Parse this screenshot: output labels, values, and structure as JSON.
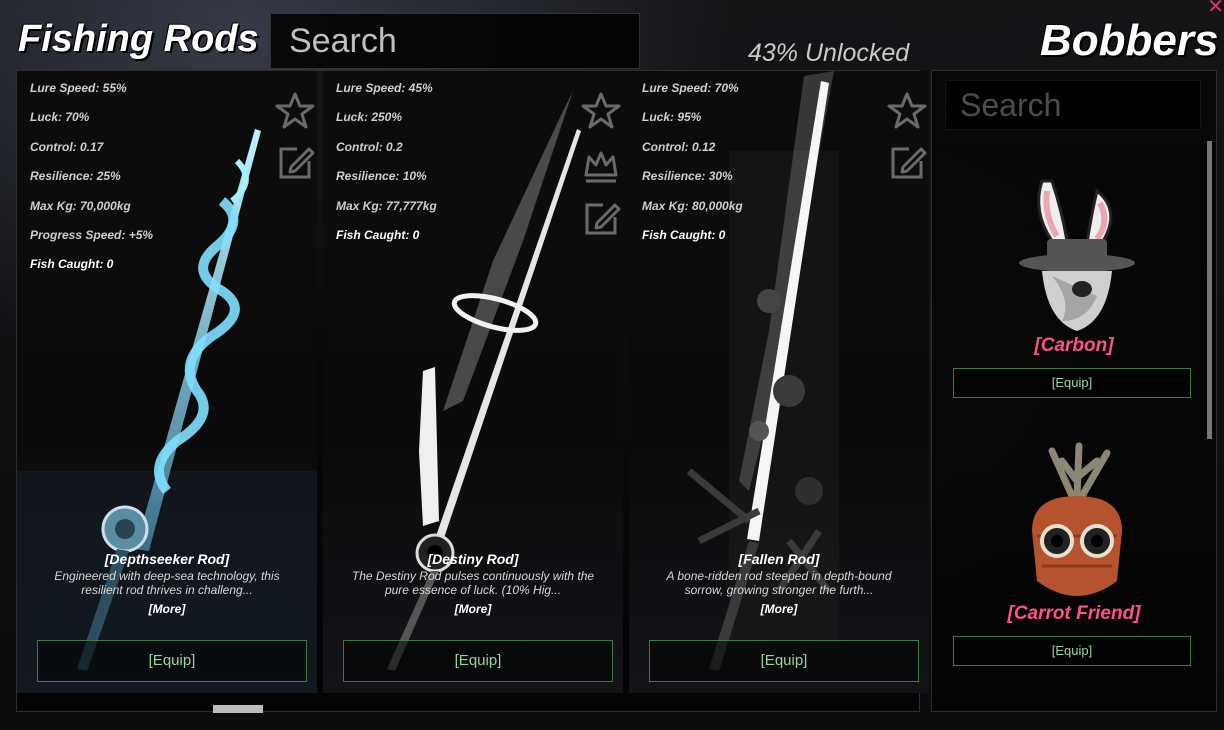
{
  "fishing_rods": {
    "title": "Fishing Rods",
    "search_placeholder": "Search",
    "unlocked_text": "43% Unlocked",
    "equip_label": "[Equip]",
    "more_label": "[More]",
    "rods": [
      {
        "stats": [
          "Lure Speed: 55%",
          "Luck: 70%",
          "Control: 0.17",
          "Resilience: 25%",
          "Max Kg: 70,000kg",
          "Progress Speed: +5%"
        ],
        "fish_caught": "Fish Caught: 0",
        "name": "[Depthseeker Rod]",
        "description": "Engineered with deep-sea technology, this resilient rod thrives in challeng...",
        "icons": [
          "star-icon",
          "edit-icon"
        ],
        "accent": "#7fe0ff"
      },
      {
        "stats": [
          "Lure Speed: 45%",
          "Luck: 250%",
          "Control: 0.2",
          "Resilience: 10%",
          "Max Kg: 77,777kg"
        ],
        "fish_caught": "Fish Caught: 0",
        "name": "[Destiny Rod]",
        "description": "The Destiny Rod pulses continuously with the pure essence of luck. (10% Hig...",
        "icons": [
          "star-icon",
          "crown-icon",
          "edit-icon"
        ],
        "accent": "#ffffff"
      },
      {
        "stats": [
          "Lure Speed: 70%",
          "Luck: 95%",
          "Control: 0.12",
          "Resilience: 30%",
          "Max Kg: 80,000kg"
        ],
        "fish_caught": "Fish Caught: 0",
        "name": "[Fallen Rod]",
        "description": "A bone-ridden rod steeped in depth-bound sorrow, growing stronger the furth...",
        "icons": [
          "star-icon",
          "edit-icon"
        ],
        "accent": "#e8e8e8"
      }
    ]
  },
  "bobbers": {
    "title": "Bobbers",
    "search_placeholder": "Search",
    "equip_label": "[Equip]",
    "items": [
      {
        "name": "[Carbon]"
      },
      {
        "name": "[Carrot Friend]"
      }
    ]
  },
  "colors": {
    "name_pink": "#ff4f8f",
    "equip_green": "#3d7a48",
    "close_pink": "#e0306a"
  }
}
